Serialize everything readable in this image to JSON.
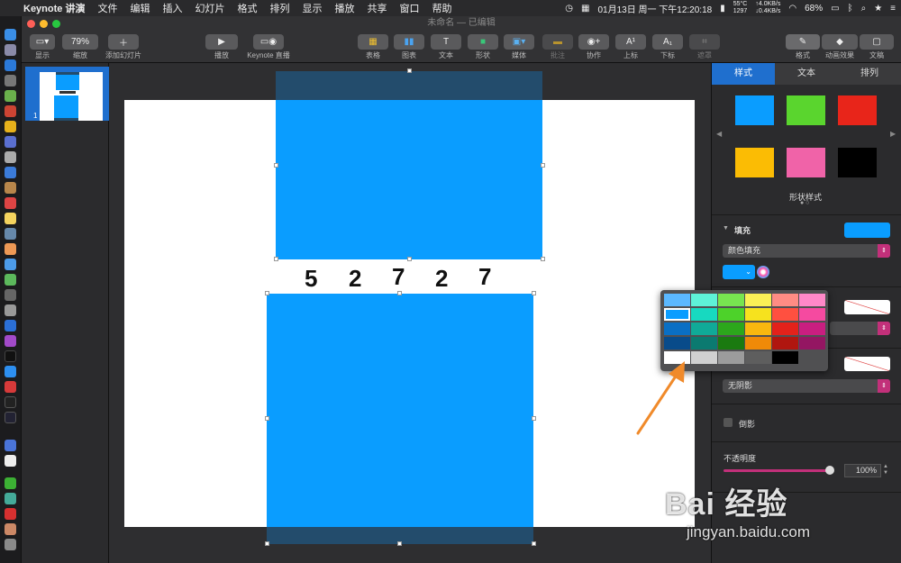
{
  "menubar": {
    "app_name": "Keynote 讲演",
    "items": [
      "文件",
      "编辑",
      "插入",
      "幻灯片",
      "格式",
      "排列",
      "显示",
      "播放",
      "共享",
      "窗口",
      "帮助"
    ],
    "temp": "55°C",
    "fan": "1297",
    "net_up": "↑4.0KB/s",
    "net_down": "↓0.4KB/s",
    "datetime": "01月13日 周一 下午12:20:18",
    "battery": "68%"
  },
  "window": {
    "title": "未命名 — 已编辑"
  },
  "toolbar": {
    "view_label": "显示",
    "zoom_value": "79%",
    "zoom_label": "缩放",
    "add_slide_label": "添加幻灯片",
    "play_label": "播放",
    "keynote_live_label": "Keynote 直播",
    "table_label": "表格",
    "chart_label": "图表",
    "text_label": "文本",
    "shape_label": "形状",
    "media_label": "媒体",
    "comment_label": "批注",
    "collaborate_label": "协作",
    "superscript_label": "上标",
    "subscript_label": "下标",
    "mask_label": "遮罩",
    "format_label": "格式",
    "animate_label": "动画效果",
    "document_label": "文稿"
  },
  "navigator": {
    "slide_number": "1"
  },
  "slide": {
    "digits": [
      "5",
      "2",
      "7",
      "2",
      "7"
    ]
  },
  "inspector": {
    "tabs": [
      "样式",
      "文本",
      "排列"
    ],
    "shape_styles_label": "形状样式",
    "fill_label": "填充",
    "fill_type": "颜色填充",
    "shadow_value": "无阴影",
    "reflection_label": "倒影",
    "opacity_label": "不透明度",
    "opacity_value": "100%"
  },
  "colors": {
    "accent": "#1f6fce",
    "shape_fill": "#0a9dff",
    "style_swatches": [
      "#0a9dff",
      "#5ad52e",
      "#e8251a",
      "#fbbc04",
      "#f063a8",
      "#000000"
    ]
  },
  "watermark": {
    "brand": "Bai 经验",
    "url": "jingyan.baidu.com"
  }
}
